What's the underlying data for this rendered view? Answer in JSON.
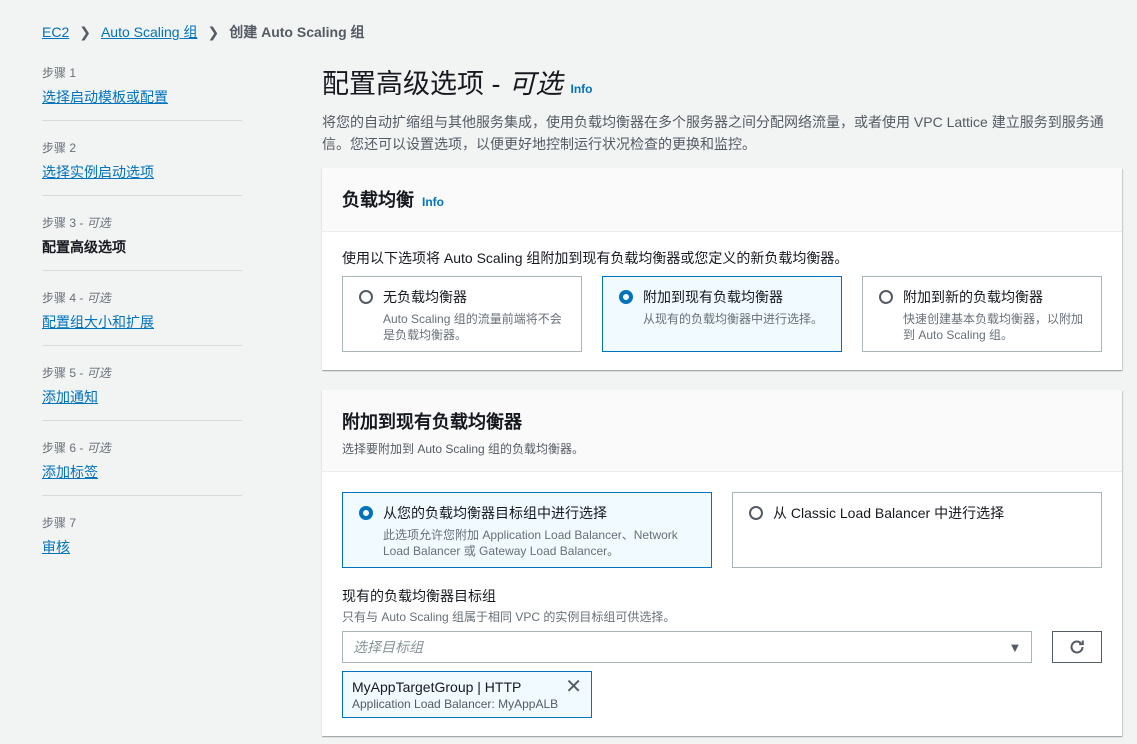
{
  "breadcrumb": {
    "items": [
      "EC2",
      "Auto Scaling 组"
    ],
    "current": "创建 Auto Scaling 组"
  },
  "steps": [
    {
      "num": "步骤 1",
      "optional": "",
      "title": "选择启动模板或配置"
    },
    {
      "num": "步骤 2",
      "optional": "",
      "title": "选择实例启动选项"
    },
    {
      "num": "步骤 3",
      "optional": "可选",
      "title": "配置高级选项"
    },
    {
      "num": "步骤 4",
      "optional": "可选",
      "title": "配置组大小和扩展"
    },
    {
      "num": "步骤 5",
      "optional": "可选",
      "title": "添加通知"
    },
    {
      "num": "步骤 6",
      "optional": "可选",
      "title": "添加标签"
    },
    {
      "num": "步骤 7",
      "optional": "",
      "title": "审核"
    }
  ],
  "page": {
    "title": "配置高级选项 -",
    "title_optional": "可选",
    "info": "Info",
    "description": "将您的自动扩缩组与其他服务集成，使用负载均衡器在多个服务器之间分配网络流量，或者使用 VPC Lattice 建立服务到服务通信。您还可以设置选项，以便更好地控制运行状况检查的更换和监控。"
  },
  "lb_card": {
    "title": "负载均衡",
    "info": "Info",
    "lead": "使用以下选项将 Auto Scaling 组附加到现有负载均衡器或您定义的新负载均衡器。",
    "options": [
      {
        "title": "无负载均衡器",
        "desc": "Auto Scaling 组的流量前端将不会是负载均衡器。"
      },
      {
        "title": "附加到现有负载均衡器",
        "desc": "从现有的负载均衡器中进行选择。"
      },
      {
        "title": "附加到新的负载均衡器",
        "desc": "快速创建基本负载均衡器，以附加到 Auto Scaling 组。"
      }
    ]
  },
  "attach_card": {
    "title": "附加到现有负载均衡器",
    "subtitle": "选择要附加到 Auto Scaling 组的负载均衡器。",
    "options": [
      {
        "title": "从您的负载均衡器目标组中进行选择",
        "desc": "此选项允许您附加 Application Load Balancer、Network Load Balancer 或 Gateway Load Balancer。"
      },
      {
        "title": "从 Classic Load Balancer 中进行选择",
        "desc": ""
      }
    ],
    "field_label": "现有的负载均衡器目标组",
    "field_desc": "只有与 Auto Scaling 组属于相同 VPC 的实例目标组可供选择。",
    "select_placeholder": "选择目标组",
    "token": {
      "title": "MyAppTargetGroup | HTTP",
      "subtitle": "Application Load Balancer: MyAppALB"
    }
  }
}
